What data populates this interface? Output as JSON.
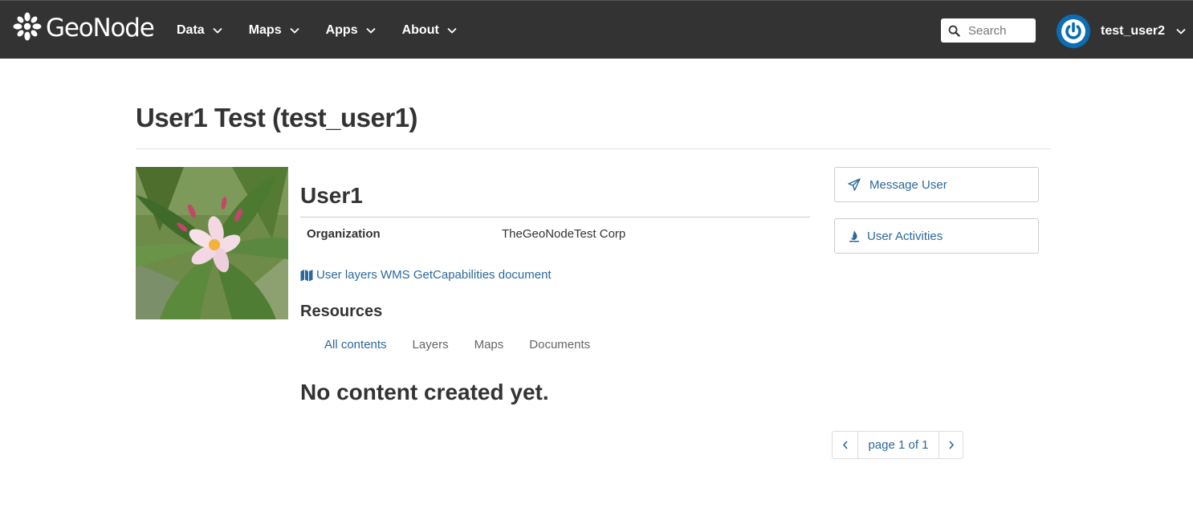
{
  "navbar": {
    "brand": "GeoNode",
    "menu": [
      {
        "label": "Data"
      },
      {
        "label": "Maps"
      },
      {
        "label": "Apps"
      },
      {
        "label": "About"
      }
    ],
    "search_placeholder": "Search",
    "username": "test_user2"
  },
  "page": {
    "title": "User1 Test (test_user1)"
  },
  "profile": {
    "name": "User1",
    "organization_label": "Organization",
    "organization_value": "TheGeoNodeTest Corp",
    "wms_link": "User layers WMS GetCapabilities document"
  },
  "resources": {
    "heading": "Resources",
    "tabs": [
      {
        "label": "All contents",
        "active": true
      },
      {
        "label": "Layers"
      },
      {
        "label": "Maps"
      },
      {
        "label": "Documents"
      }
    ],
    "empty_message": "No content created yet."
  },
  "pagination": {
    "label": "page 1 of 1"
  },
  "actions": {
    "message_user": "Message User",
    "user_activities": "User Activities"
  },
  "colors": {
    "navbar_bg": "#333333",
    "link": "#2c689c",
    "avatar": "#0b6db3"
  },
  "icons": {
    "logo": "geonode-flower-icon",
    "search": "search-icon",
    "avatar": "power-icon",
    "map": "map-icon",
    "message": "paper-plane-icon",
    "activities": "fire-icon",
    "prev": "chevron-left-icon",
    "next": "chevron-right-icon"
  }
}
